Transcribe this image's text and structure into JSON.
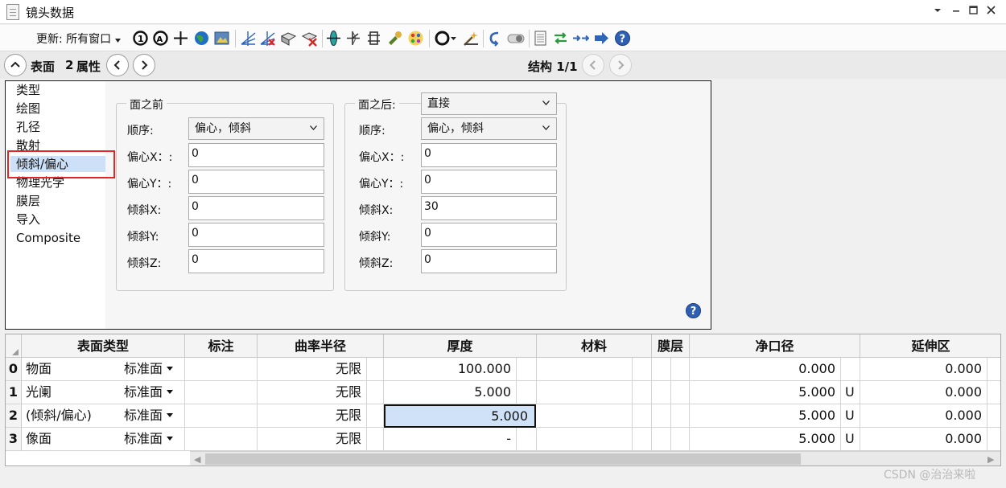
{
  "window": {
    "title": "镜头数据"
  },
  "toolbar": {
    "update_label": "更新: 所有窗口",
    "icons": [
      "refresh-icon",
      "refresh-all-icon",
      "crosshair-icon",
      "globe-icon",
      "image-icon",
      "fan-icon",
      "fan-cross-icon",
      "shaded-model-icon",
      "shaded-delete-icon",
      "lens-icon",
      "ray-icon",
      "gear-lens-icon",
      "tool-icon",
      "palette-icon",
      "ring-icon",
      "wand-icon",
      "undo-icon",
      "toggle-icon",
      "page-icon",
      "swap-icon",
      "arrows-icon",
      "arrow-right-icon",
      "help-icon"
    ]
  },
  "nav": {
    "surface_label": "表面",
    "surface_number": "2",
    "attr_label": "属性",
    "config_label": "结构 1/1"
  },
  "categories": [
    {
      "label": "类型",
      "selected": false
    },
    {
      "label": "绘图",
      "selected": false
    },
    {
      "label": "孔径",
      "selected": false
    },
    {
      "label": "散射",
      "selected": false
    },
    {
      "label": "倾斜/偏心",
      "selected": true
    },
    {
      "label": "物理光学",
      "selected": false
    },
    {
      "label": "膜层",
      "selected": false
    },
    {
      "label": "导入",
      "selected": false
    },
    {
      "label": "Composite",
      "selected": false
    }
  ],
  "before": {
    "legend": "面之前",
    "order_label": "顺序:",
    "order_value": "偏心，倾斜",
    "decenter_x_label": "偏心X：:",
    "decenter_x": "0",
    "decenter_y_label": "偏心Y：:",
    "decenter_y": "0",
    "tilt_x_label": "倾斜X:",
    "tilt_x": "0",
    "tilt_y_label": "倾斜Y:",
    "tilt_y": "0",
    "tilt_z_label": "倾斜Z:",
    "tilt_z": "0"
  },
  "after": {
    "legend": "面之后:",
    "mode_value": "直接",
    "order_label": "顺序:",
    "order_value": "偏心，倾斜",
    "decenter_x_label": "偏心X：:",
    "decenter_x": "0",
    "decenter_y_label": "偏心Y：:",
    "decenter_y": "0",
    "tilt_x_label": "倾斜X:",
    "tilt_x": "30",
    "tilt_y_label": "倾斜Y:",
    "tilt_y": "0",
    "tilt_z_label": "倾斜Z:",
    "tilt_z": "0"
  },
  "grid": {
    "columns": [
      "表面类型",
      "标注",
      "曲率半径",
      "厚度",
      "材料",
      "膜层",
      "净口径",
      "延伸区"
    ],
    "rows": [
      {
        "index": "0",
        "name": "物面",
        "type": "标准面",
        "radius": "无限",
        "thickness": "100.000",
        "clear": "0.000",
        "clear_flag": "",
        "ext": "0.000"
      },
      {
        "index": "1",
        "name": "光阑",
        "type": "标准面",
        "radius": "无限",
        "thickness": "5.000",
        "clear": "5.000",
        "clear_flag": "U",
        "ext": "0.000"
      },
      {
        "index": "2",
        "name": "(倾斜/偏心)",
        "type": "标准面",
        "radius": "无限",
        "thickness": "5.000",
        "clear": "5.000",
        "clear_flag": "U",
        "ext": "0.000"
      },
      {
        "index": "3",
        "name": "像面",
        "type": "标准面",
        "radius": "无限",
        "thickness": "-",
        "clear": "5.000",
        "clear_flag": "U",
        "ext": "0.000"
      }
    ]
  },
  "watermark": "CSDN @治治来啦",
  "colors": {
    "selection": "#cce0f7",
    "highlight_box": "#e02626",
    "accent": "#2f5fb2"
  }
}
